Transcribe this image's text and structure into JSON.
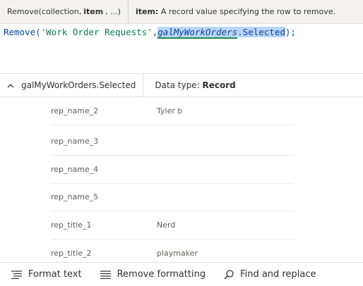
{
  "signature_help": {
    "func_prefix": "Remove(collection,",
    "param_current": "item",
    "func_suffix": ", ...)",
    "param_name": "item:",
    "param_desc": "A record value specifying the row to remove."
  },
  "formula": {
    "func": "Remove(",
    "string_arg": "'Work Order Requests'",
    "comma": ",",
    "control": "galMyWorkOrders",
    "property": ".Selected",
    "close": ");"
  },
  "type_bar": {
    "expression": "galMyWorkOrders.Selected",
    "type_label": "Data type:",
    "type_value": "Record"
  },
  "rows": [
    {
      "key": "rep_name_2",
      "value": "Tyler b"
    },
    {
      "key": "rep_name_3",
      "value": ""
    },
    {
      "key": "rep_name_4",
      "value": ""
    },
    {
      "key": "rep_name_5",
      "value": ""
    },
    {
      "key": "rep_title_1",
      "value": "Nerd"
    },
    {
      "key": "rep_title_2",
      "value": "playmaker"
    }
  ],
  "toolbar": {
    "format_text": "Format text",
    "remove_formatting": "Remove formatting",
    "find_replace": "Find and replace"
  },
  "icons": {
    "format": "format-text-icon",
    "remove": "remove-formatting-icon",
    "find": "search-icon",
    "chevron": "chevron-up-icon"
  }
}
